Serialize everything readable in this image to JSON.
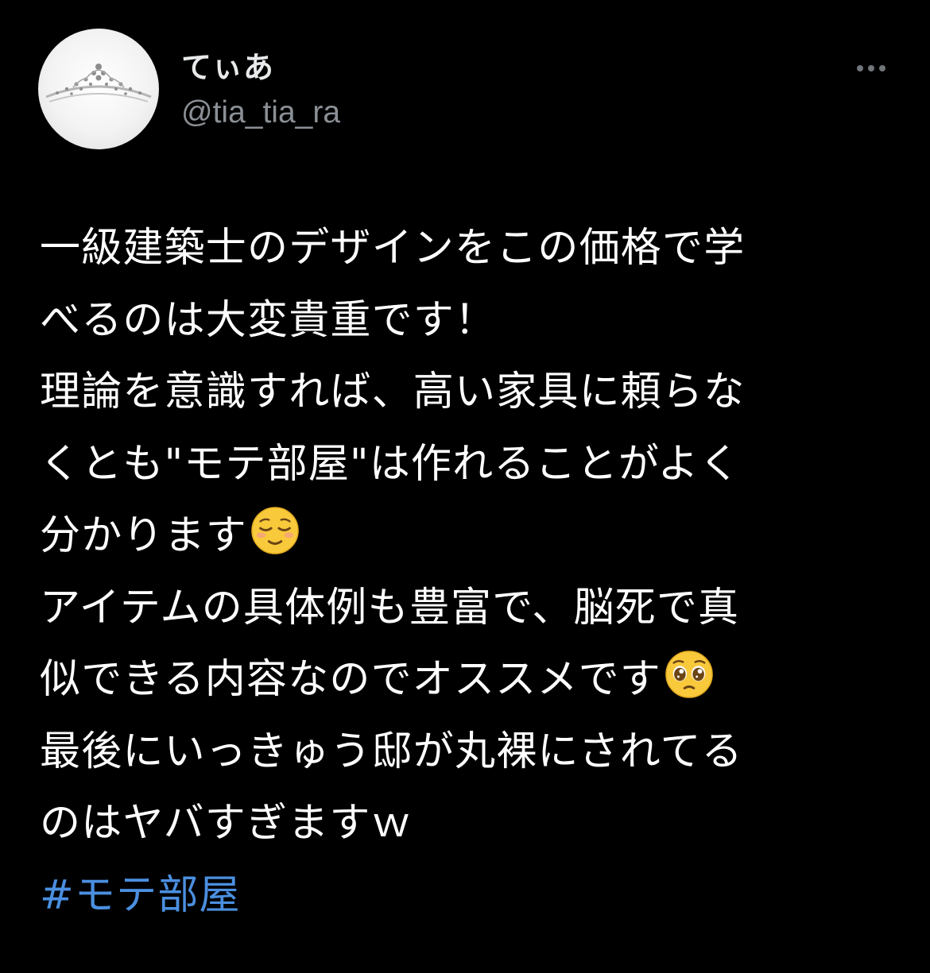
{
  "author": {
    "display_name": "てぃあ",
    "handle": "@tia_tia_ra",
    "avatar_icon": "tiara-avatar-icon"
  },
  "menu": {
    "icon": "more-options-icon"
  },
  "tweet": {
    "lines": [
      "一級建築士のデザインをこの価格で学",
      "べるのは大変貴重です！",
      "理論を意識すれば、高い家具に頼らな",
      "くとも\"モテ部屋\"は作れることがよく",
      "分かります",
      "アイテムの具体例も豊富で、脳死で真",
      "似できる内容なのでオススメです",
      "最後にいっきゅう邸が丸裸にされてる",
      "のはヤバすぎますｗ"
    ],
    "emojis": {
      "relieved": "relieved-face-emoji",
      "pleading": "pleading-face-emoji"
    },
    "hashtag": "#モテ部屋"
  },
  "colors": {
    "background": "#000000",
    "text": "#ffffff",
    "handle": "#8b9096",
    "hashtag": "#4b8fe0"
  }
}
